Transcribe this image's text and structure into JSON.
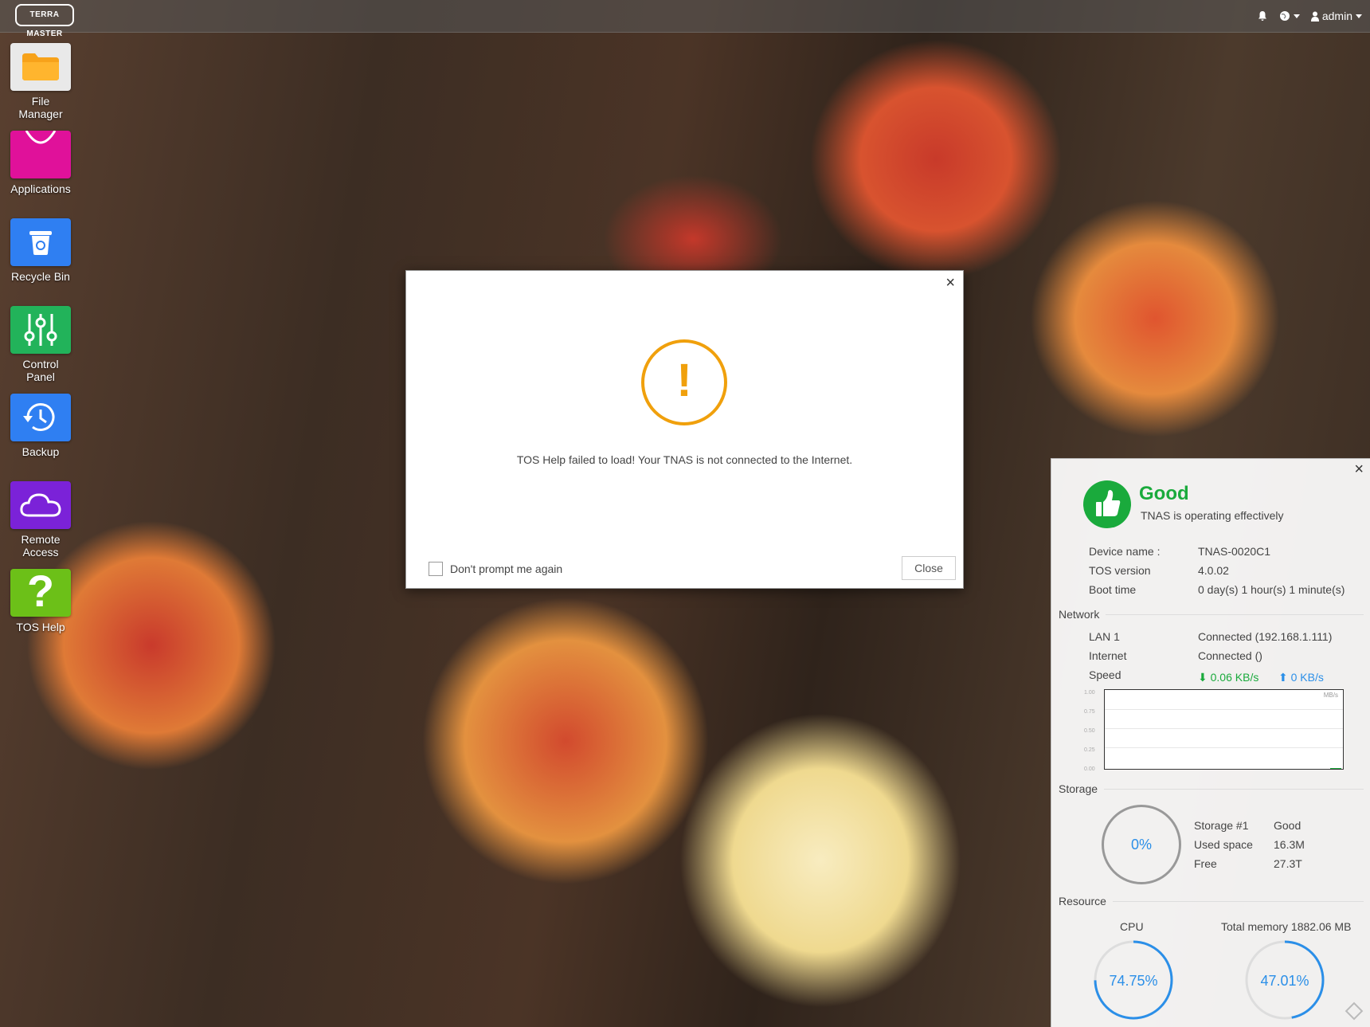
{
  "topbar": {
    "logo_text": "TERRA MASTER",
    "user": "admin"
  },
  "desktop_icons": [
    {
      "label": "File Manager",
      "color": "#e8e8e8",
      "icon": "folder-icon"
    },
    {
      "label": "Applications",
      "color": "#e0119a",
      "icon": "shopping-bag-icon"
    },
    {
      "label": "Recycle Bin",
      "color": "#2b7cf0",
      "icon": "recycle-bin-icon"
    },
    {
      "label": "Control Panel",
      "color": "#22b35a",
      "icon": "sliders-icon"
    },
    {
      "label": "Backup",
      "color": "#2b7cf0",
      "icon": "clock-history-icon"
    },
    {
      "label": "Remote Access",
      "color": "#7b22d8",
      "icon": "cloud-icon"
    },
    {
      "label": "TOS Help",
      "color": "#6cc018",
      "icon": "question-icon"
    }
  ],
  "dialog": {
    "close_glyph": "×",
    "warning_glyph": "!",
    "message": "TOS Help failed to load! Your TNAS is not connected to the Internet.",
    "checkbox_label": "Don't prompt me again",
    "close_button": "Close"
  },
  "status": {
    "close_glyph": "×",
    "title": "Good",
    "subtitle": "TNAS is operating effectively",
    "device_name_label": "Device name :",
    "device_name": "TNAS-0020C1",
    "tos_version_label": "TOS version",
    "tos_version": "4.0.02",
    "boot_time_label": "Boot time",
    "boot_time": "0 day(s) 1 hour(s) 1 minute(s)",
    "network": {
      "heading": "Network",
      "lan_label": "LAN 1",
      "lan_value": "Connected (192.168.1.111)",
      "internet_label": "Internet",
      "internet_value": "Connected ()",
      "speed_label": "Speed",
      "download": "0.06 KB/s",
      "upload": "0 KB/s",
      "chart_unit": "MB/s",
      "y_ticks": [
        "1.00",
        "0.75",
        "0.50",
        "0.25",
        "0.00"
      ]
    },
    "storage": {
      "heading": "Storage",
      "usage_percent": "0%",
      "pool_label": "Storage #1",
      "pool_status": "Good",
      "used_label": "Used space",
      "used_value": "16.3M",
      "free_label": "Free",
      "free_value": "27.3T"
    },
    "resource": {
      "heading": "Resource",
      "cpu_label": "CPU",
      "cpu_value": "74.75%",
      "cpu_fraction": 0.7475,
      "memory_label": "Total memory 1882.06 MB",
      "memory_value": "47.01%",
      "memory_fraction": 0.4701
    }
  }
}
